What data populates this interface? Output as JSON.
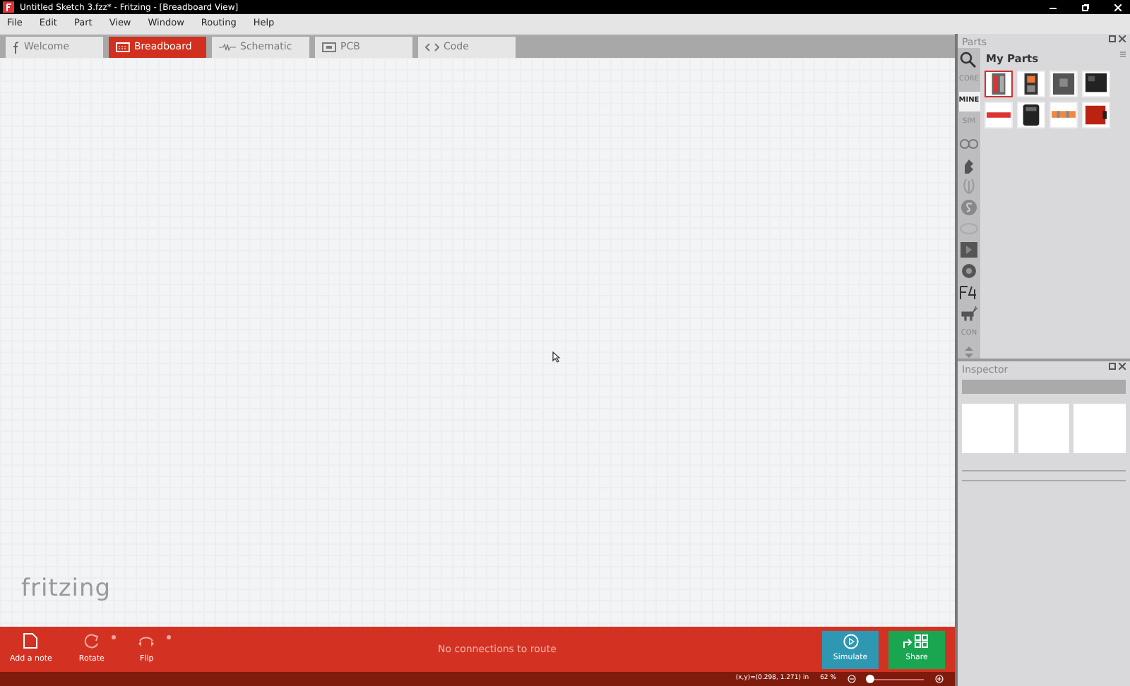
{
  "window": {
    "title": "Untitled Sketch 3.fzz* - Fritzing - [Breadboard View]"
  },
  "menu": [
    "File",
    "Edit",
    "Part",
    "View",
    "Window",
    "Routing",
    "Help"
  ],
  "tabs": [
    {
      "label": "Welcome",
      "kind": "welcome",
      "selected": false
    },
    {
      "label": "Breadboard",
      "kind": "breadboard",
      "selected": true
    },
    {
      "label": "Schematic",
      "kind": "schematic",
      "selected": false
    },
    {
      "label": "PCB",
      "kind": "pcb",
      "selected": false
    },
    {
      "label": "Code",
      "kind": "code",
      "selected": false
    }
  ],
  "canvas": {
    "logo": "fritzing"
  },
  "toolbar": {
    "tools": [
      {
        "label": "Add a note",
        "kind": "note",
        "dropdown": false
      },
      {
        "label": "Rotate",
        "kind": "rotate",
        "dropdown": true
      },
      {
        "label": "Flip",
        "kind": "flip",
        "dropdown": true
      }
    ],
    "routing_status": "No connections to route",
    "actions": [
      {
        "label": "Simulate",
        "kind": "simulate"
      },
      {
        "label": "Share",
        "kind": "share"
      }
    ]
  },
  "status_bar": {
    "coordinates": "(x,y)=(0.298, 1.271) in",
    "zoom": "62 %",
    "zoom_slider": {
      "level": 0.05
    }
  },
  "parts_panel": {
    "title": "Parts",
    "bin_title": "My Parts",
    "bins": [
      {
        "kind": "search",
        "selected": false
      },
      {
        "kind": "text",
        "label": "CORE",
        "selected": false
      },
      {
        "kind": "text",
        "label": "MINE",
        "selected": true
      },
      {
        "kind": "text",
        "label": "SIM",
        "selected": false
      },
      {
        "kind": "glasses",
        "selected": false
      },
      {
        "kind": "hand",
        "selected": false
      },
      {
        "kind": "seeed",
        "selected": false
      },
      {
        "kind": "s-circle",
        "selected": false
      },
      {
        "kind": "oval",
        "selected": false
      },
      {
        "kind": "play",
        "selected": false
      },
      {
        "kind": "round",
        "selected": false
      },
      {
        "kind": "f4",
        "selected": false
      },
      {
        "kind": "animal",
        "selected": false
      },
      {
        "kind": "text",
        "label": "CON",
        "selected": false
      }
    ],
    "parts": [
      {
        "kind": "board",
        "selected": true
      },
      {
        "kind": "module",
        "selected": false
      },
      {
        "kind": "grey",
        "selected": false
      },
      {
        "kind": "black",
        "selected": false
      },
      {
        "kind": "strip",
        "selected": false
      },
      {
        "kind": "box",
        "selected": false
      },
      {
        "kind": "orange",
        "selected": false
      },
      {
        "kind": "red",
        "selected": false
      }
    ]
  },
  "inspector": {
    "title": "Inspector"
  }
}
